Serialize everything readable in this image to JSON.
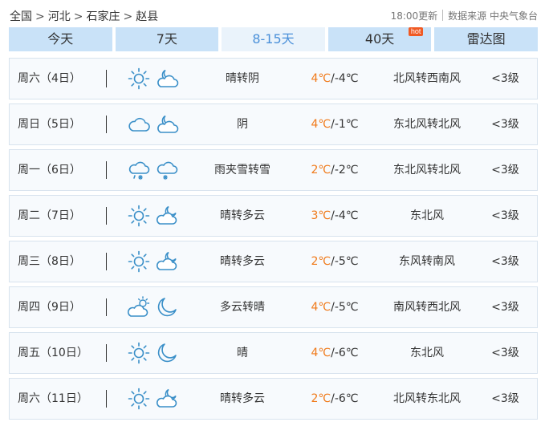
{
  "breadcrumb": {
    "items": [
      "全国",
      "河北",
      "石家庄",
      "赵县"
    ],
    "separator": ">"
  },
  "source": {
    "updated": "18:00更新",
    "data_source": "数据来源 中央气象台"
  },
  "tabs": [
    {
      "label": "今天"
    },
    {
      "label": "7天"
    },
    {
      "label": "8-15天"
    },
    {
      "label": "40天",
      "badge": "hot"
    },
    {
      "label": "雷达图"
    }
  ],
  "active_tab": "8-15天",
  "colors": {
    "icon_blue": "#3a8fc8",
    "temp_high": "#f07a1a",
    "tab_bg": "#c9e2f8",
    "tab_active_text": "#4a90d9",
    "hot_badge": "#f05a24"
  },
  "forecast": [
    {
      "day": "周六（4日）",
      "icon_day": "sun-icon",
      "icon_night": "cloudy-night-icon",
      "desc": "晴转阴",
      "high": "4℃",
      "low": "/-4℃",
      "wind": "北风转西南风",
      "level": "<3级"
    },
    {
      "day": "周日（5日）",
      "icon_day": "cloud-icon",
      "icon_night": "cloudy-night-icon",
      "desc": "阴",
      "high": "4℃",
      "low": "/-1℃",
      "wind": "东北风转北风",
      "level": "<3级"
    },
    {
      "day": "周一（6日）",
      "icon_day": "sleet-icon",
      "icon_night": "snow-icon",
      "desc": "雨夹雪转雪",
      "high": "2℃",
      "low": "/-2℃",
      "wind": "东北风转北风",
      "level": "<3级"
    },
    {
      "day": "周二（7日）",
      "icon_day": "sun-icon",
      "icon_night": "partly-cloudy-night-icon",
      "desc": "晴转多云",
      "high": "3℃",
      "low": "/-4℃",
      "wind": "东北风",
      "level": "<3级"
    },
    {
      "day": "周三（8日）",
      "icon_day": "sun-icon",
      "icon_night": "partly-cloudy-night-icon",
      "desc": "晴转多云",
      "high": "2℃",
      "low": "/-5℃",
      "wind": "东风转南风",
      "level": "<3级"
    },
    {
      "day": "周四（9日）",
      "icon_day": "partly-cloudy-day-icon",
      "icon_night": "moon-icon",
      "desc": "多云转晴",
      "high": "4℃",
      "low": "/-5℃",
      "wind": "南风转西北风",
      "level": "<3级"
    },
    {
      "day": "周五（10日）",
      "icon_day": "sun-icon",
      "icon_night": "moon-icon",
      "desc": "晴",
      "high": "4℃",
      "low": "/-6℃",
      "wind": "东北风",
      "level": "<3级"
    },
    {
      "day": "周六（11日）",
      "icon_day": "sun-icon",
      "icon_night": "partly-cloudy-night-icon",
      "desc": "晴转多云",
      "high": "2℃",
      "low": "/-6℃",
      "wind": "北风转东北风",
      "level": "<3级"
    }
  ]
}
